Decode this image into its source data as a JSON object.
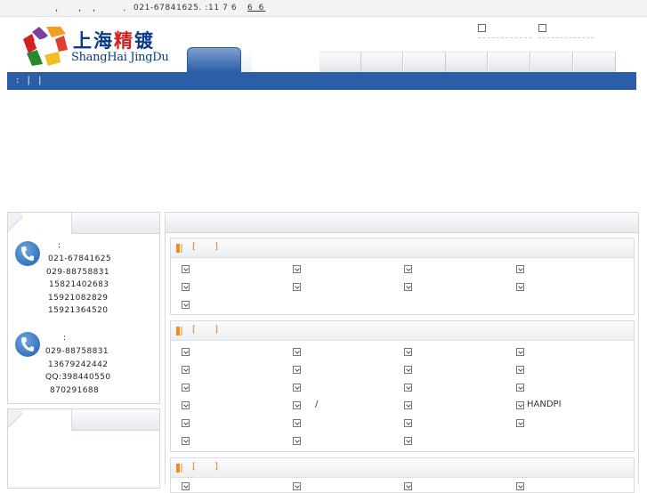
{
  "topbar": {
    "separators": [
      ",",
      ",",
      ",",
      "."
    ],
    "phone_text": "021-67841625.  :11 7 6",
    "visit_count": "6 6"
  },
  "header": {
    "logo_cn_1": "上海",
    "logo_cn_2": "精",
    "logo_cn_3": "镀",
    "logo_en": "ShangHai JingDu"
  },
  "bluebar": {
    "text": ":  |  |"
  },
  "contact_block_1": {
    "colon": ":",
    "lines": [
      "021-67841625",
      "029-88758831",
      "15821402683",
      "15921082829",
      "15921364520"
    ]
  },
  "contact_block_2": {
    "colon": ":",
    "lines": [
      "029-88758831",
      "13679242442",
      "QQ:398440550",
      "870291688"
    ]
  },
  "sections": [
    {
      "bracket": "[ ]"
    },
    {
      "bracket": "[ ]"
    },
    {
      "bracket": "[ ]"
    }
  ],
  "section2_extra": {
    "slash": "/",
    "handpi": "HANDPI"
  },
  "colors": {
    "nav_blue": "#2b5ea6",
    "accent_orange": "#f08a1c",
    "logo_blue": "#0a3a8a",
    "logo_red": "#d02020"
  }
}
